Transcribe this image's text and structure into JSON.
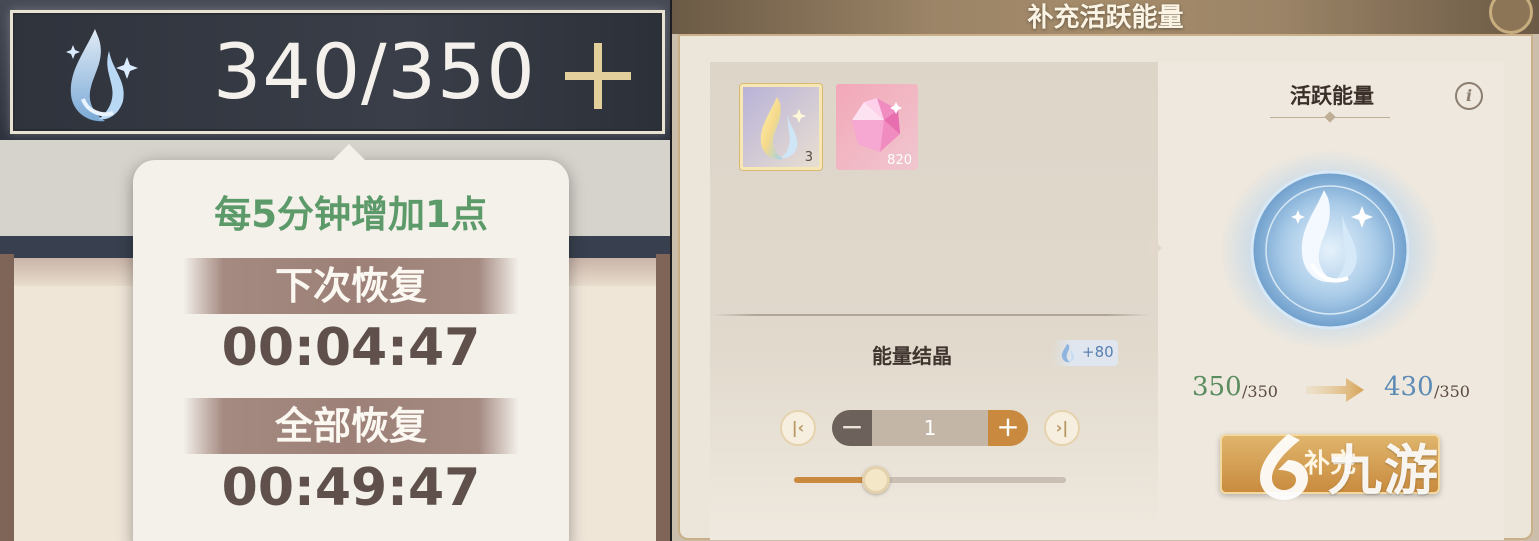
{
  "left": {
    "energy_count": "340/350",
    "tooltip": {
      "rate": "每5分钟增加1点",
      "next_label": "下次恢复",
      "next_time": "00:04:47",
      "full_label": "全部恢复",
      "full_time": "00:49:47"
    }
  },
  "right": {
    "title": "补充活跃能量",
    "items": [
      {
        "name": "energy-item",
        "count": "3"
      },
      {
        "name": "gem-item",
        "count": "820"
      }
    ],
    "item_name": "能量结晶",
    "bonus": "+80",
    "quantity": "1",
    "quantity_fraction": 0.3,
    "energy_label": "活跃能量",
    "info_glyph": "i",
    "current_value": "350",
    "current_max": "/350",
    "new_value": "430",
    "new_max": "/350",
    "confirm_label": "补充"
  },
  "watermark": "九游",
  "colors": {
    "green": "#5d9a69",
    "blue": "#5c8bb5",
    "gold": "#c98a3f",
    "cream": "#f4f1eb"
  }
}
